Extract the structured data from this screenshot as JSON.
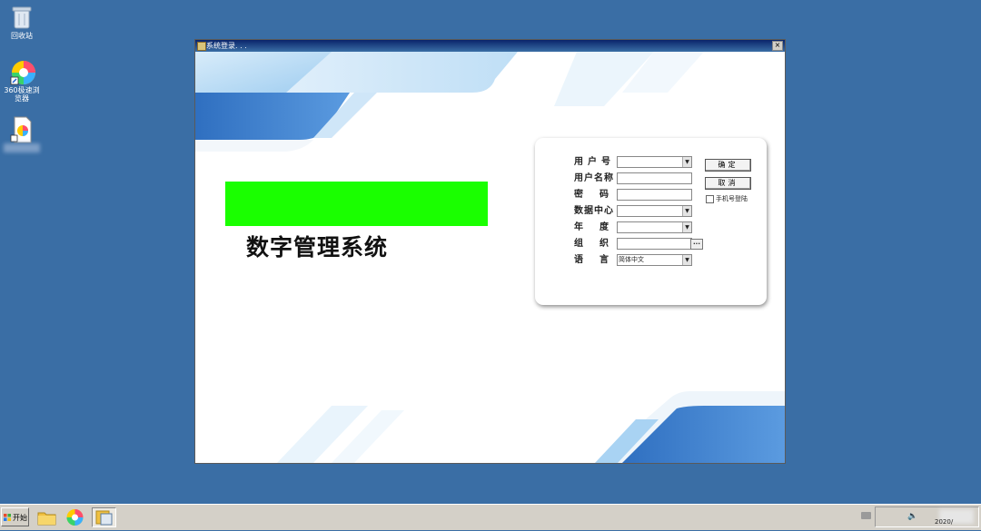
{
  "desktop": {
    "icons": [
      {
        "label": "回收站",
        "icon": "recycle-bin-icon"
      },
      {
        "label": "360极速浏览器",
        "icon": "browser-360-icon"
      },
      {
        "label": "",
        "icon": "shortcut-doc-icon"
      }
    ]
  },
  "window": {
    "title": "系统登录. . .",
    "close_label": "×"
  },
  "app": {
    "title": "数字管理系统",
    "banner_color": "#1aff00"
  },
  "login": {
    "fields": [
      {
        "label": "用户号",
        "value": "",
        "type": "dropdown"
      },
      {
        "label": "用户名称",
        "value": "",
        "type": "text"
      },
      {
        "label": "密码",
        "value": "",
        "type": "password"
      },
      {
        "label": "数据中心",
        "value": "",
        "type": "dropdown"
      },
      {
        "label": "年度",
        "value": "",
        "type": "dropdown"
      },
      {
        "label": "组织",
        "value": "",
        "type": "text-ellipsis"
      },
      {
        "label": "语言",
        "value": "简体中文",
        "type": "dropdown"
      }
    ],
    "ok_label": "确定",
    "cancel_label": "取消",
    "phone_login_label": "手机号登陆",
    "ellipsis_label": "..."
  },
  "taskbar": {
    "start_label": "开始",
    "clock": "2020/"
  },
  "colors": {
    "desktop": "#3a6ea5",
    "accent_blue": "#4a86c8"
  }
}
